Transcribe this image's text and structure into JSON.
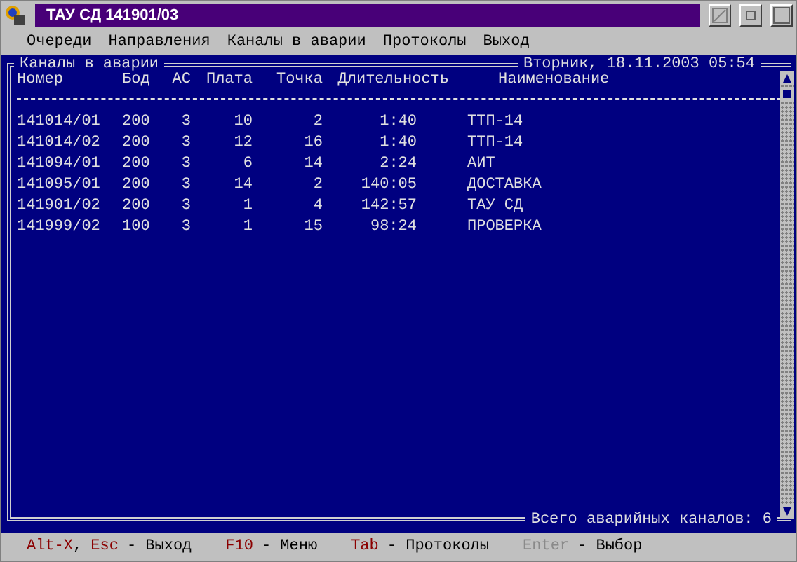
{
  "window": {
    "title": "ТАУ СД 141901/03"
  },
  "menu": [
    "Очереди",
    "Направления",
    "Каналы в аварии",
    "Протоколы",
    "Выход"
  ],
  "panel": {
    "title": "Каналы в аварии",
    "datetime": "Вторник, 18.11.2003 05:54",
    "footer": "Всего аварийных каналов: 6"
  },
  "table": {
    "columns": [
      "Номер",
      "Бод",
      "АС",
      "Плата",
      "Точка",
      "Длительность",
      "Наименование"
    ],
    "rows": [
      [
        "141014/01",
        "200",
        "3",
        "10",
        "2",
        "1:40",
        "ТТП-14"
      ],
      [
        "141014/02",
        "200",
        "3",
        "12",
        "16",
        "1:40",
        "ТТП-14"
      ],
      [
        "141094/01",
        "200",
        "3",
        "6",
        "14",
        "2:24",
        "АИТ"
      ],
      [
        "141095/01",
        "200",
        "3",
        "14",
        "2",
        "140:05",
        "ДОСТАВКА"
      ],
      [
        "141901/02",
        "200",
        "3",
        "1",
        "4",
        "142:57",
        "ТАУ СД"
      ],
      [
        "141999/02",
        "100",
        "3",
        "1",
        "15",
        "98:24",
        "ПРОВЕРКА"
      ]
    ]
  },
  "status_bar": [
    {
      "parts": [
        {
          "text": "Alt-X",
          "kind": "key"
        },
        {
          "text": ",",
          "kind": "plain"
        },
        {
          "text": "Esc",
          "kind": "key"
        },
        {
          "text": "- Выход",
          "kind": "plain"
        }
      ]
    },
    {
      "parts": [
        {
          "text": "F10",
          "kind": "key"
        },
        {
          "text": "- Меню",
          "kind": "plain"
        }
      ]
    },
    {
      "parts": [
        {
          "text": "Tab",
          "kind": "key"
        },
        {
          "text": "- Протоколы",
          "kind": "plain"
        }
      ]
    },
    {
      "parts": [
        {
          "text": "Enter",
          "kind": "disabled"
        },
        {
          "text": "- Выбор",
          "kind": "plain"
        }
      ]
    }
  ]
}
